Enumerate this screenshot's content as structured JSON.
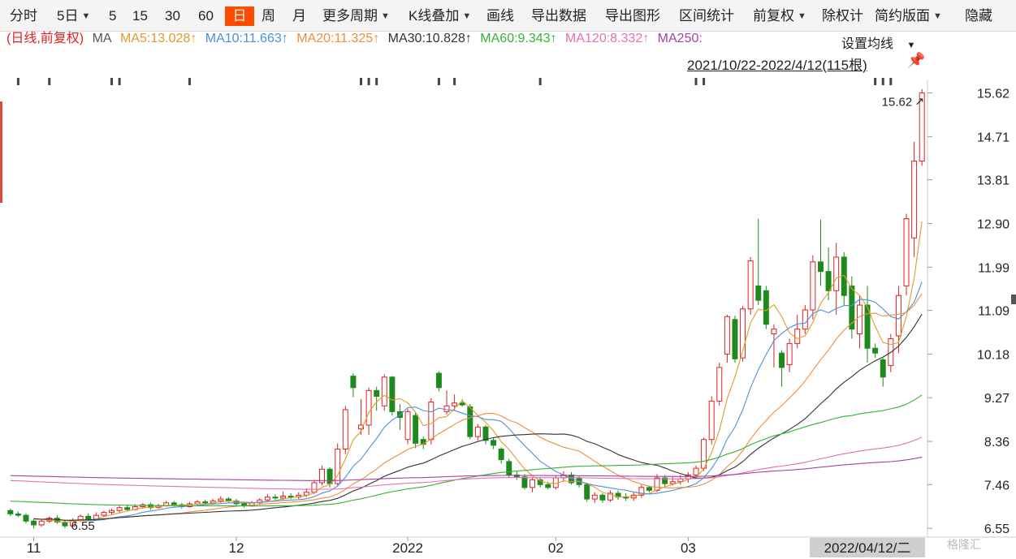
{
  "toolbar": {
    "items": [
      {
        "label": "分时"
      },
      {
        "label": "5日"
      },
      {
        "label": "5"
      },
      {
        "label": "15"
      },
      {
        "label": "30"
      },
      {
        "label": "60"
      },
      {
        "label": "日"
      },
      {
        "label": "周"
      },
      {
        "label": "月"
      },
      {
        "label": "更多周期"
      },
      {
        "label": "K线叠加"
      },
      {
        "label": "画线"
      },
      {
        "label": "导出数据"
      },
      {
        "label": "导出图形"
      },
      {
        "label": "区间统计"
      },
      {
        "label": "前复权"
      },
      {
        "label": "除权计"
      },
      {
        "label": "简约版面"
      },
      {
        "label": "隐藏"
      }
    ],
    "active": "日"
  },
  "ma_legend": {
    "prefix": "(日线,前复权)",
    "ma_label": "MA",
    "items": [
      {
        "text": "MA5:13.028↑",
        "color": "#e39a29"
      },
      {
        "text": "MA10:11.663↑",
        "color": "#4a90d9"
      },
      {
        "text": "MA20:11.325↑",
        "color": "#f08c3a"
      },
      {
        "text": "MA30:10.828↑",
        "color": "#333333"
      },
      {
        "text": "MA60:9.343↑",
        "color": "#34b234"
      },
      {
        "text": "MA120:8.332↑",
        "color": "#e86fb1"
      },
      {
        "text": "MA250:",
        "color": "#a640a6"
      }
    ],
    "settings_label": "设置均线"
  },
  "range_label": "2021/10/22-2022/4/12(115根)",
  "watermark": "格隆汇",
  "colors": {
    "up": "#e02020",
    "down": "#1e8a1e",
    "active_tab": "#ff4a00"
  },
  "chart_data": {
    "type": "candlestick",
    "ylim": [
      6.4,
      15.9
    ],
    "y_ticks": [
      "15.62",
      "14.71",
      "13.81",
      "12.90",
      "11.99",
      "11.09",
      "10.18",
      "9.27",
      "8.36",
      "7.46",
      "6.55"
    ],
    "x_labels": [
      "11",
      "12",
      "2022",
      "02",
      "03"
    ],
    "current_date_label": "2022/04/12/二",
    "high_annotation": "15.62",
    "low_annotation": "6.55",
    "candles": [
      [
        6.92,
        6.85,
        6.96,
        6.8
      ],
      [
        6.85,
        6.82,
        6.9,
        6.78
      ],
      [
        6.82,
        6.7,
        6.86,
        6.65
      ],
      [
        6.7,
        6.62,
        6.75,
        6.55
      ],
      [
        6.62,
        6.7,
        6.74,
        6.58
      ],
      [
        6.7,
        6.76,
        6.8,
        6.66
      ],
      [
        6.76,
        6.68,
        6.82,
        6.64
      ],
      [
        6.68,
        6.6,
        6.72,
        6.55
      ],
      [
        6.6,
        6.72,
        6.76,
        6.58
      ],
      [
        6.72,
        6.8,
        6.84,
        6.68
      ],
      [
        6.8,
        6.74,
        6.86,
        6.7
      ],
      [
        6.74,
        6.82,
        6.88,
        6.72
      ],
      [
        6.82,
        6.88,
        6.92,
        6.78
      ],
      [
        6.88,
        6.92,
        6.96,
        6.84
      ],
      [
        6.92,
        6.98,
        7.02,
        6.88
      ],
      [
        6.98,
        6.94,
        7.04,
        6.9
      ],
      [
        6.94,
        7.0,
        7.05,
        6.92
      ],
      [
        7.0,
        7.04,
        7.08,
        6.96
      ],
      [
        7.04,
        6.98,
        7.08,
        6.94
      ],
      [
        6.98,
        7.02,
        7.06,
        6.96
      ],
      [
        7.02,
        7.08,
        7.12,
        7.0
      ],
      [
        7.08,
        7.04,
        7.12,
        7.0
      ],
      [
        7.04,
        7.0,
        7.08,
        6.96
      ],
      [
        7.0,
        7.06,
        7.1,
        6.98
      ],
      [
        7.06,
        7.1,
        7.14,
        7.02
      ],
      [
        7.1,
        7.08,
        7.14,
        7.04
      ],
      [
        7.08,
        7.12,
        7.16,
        7.04
      ],
      [
        7.12,
        7.16,
        7.22,
        7.08
      ],
      [
        7.16,
        7.12,
        7.2,
        7.08
      ],
      [
        7.12,
        7.06,
        7.16,
        7.02
      ],
      [
        7.06,
        7.02,
        7.1,
        6.98
      ],
      [
        7.02,
        7.08,
        7.12,
        7.0
      ],
      [
        7.08,
        7.14,
        7.18,
        7.04
      ],
      [
        7.14,
        7.2,
        7.26,
        7.1
      ],
      [
        7.2,
        7.18,
        7.26,
        7.14
      ],
      [
        7.18,
        7.22,
        7.32,
        7.14
      ],
      [
        7.22,
        7.2,
        7.28,
        7.16
      ],
      [
        7.2,
        7.24,
        7.3,
        7.16
      ],
      [
        7.24,
        7.3,
        7.38,
        7.2
      ],
      [
        7.3,
        7.5,
        7.56,
        7.26
      ],
      [
        7.5,
        7.78,
        7.86,
        7.44
      ],
      [
        7.78,
        7.48,
        7.82,
        7.4
      ],
      [
        7.48,
        8.2,
        8.32,
        7.44
      ],
      [
        8.2,
        9.02,
        9.1,
        8.1
      ],
      [
        9.72,
        9.48,
        9.78,
        9.28
      ],
      [
        8.62,
        8.7,
        9.24,
        8.5
      ],
      [
        8.7,
        9.42,
        9.48,
        8.5
      ],
      [
        9.42,
        9.3,
        9.5,
        9.0
      ],
      [
        9.1,
        9.7,
        9.76,
        9.0
      ],
      [
        9.7,
        8.98,
        9.72,
        8.9
      ],
      [
        8.98,
        8.86,
        9.14,
        8.6
      ],
      [
        8.4,
        8.98,
        9.04,
        8.3
      ],
      [
        8.9,
        8.32,
        8.96,
        8.22
      ],
      [
        8.4,
        8.3,
        8.46,
        8.2
      ],
      [
        8.4,
        9.18,
        9.26,
        8.3
      ],
      [
        9.78,
        9.48,
        9.82,
        9.4
      ],
      [
        8.98,
        9.1,
        9.42,
        8.92
      ],
      [
        9.1,
        9.16,
        9.34,
        9.0
      ],
      [
        9.16,
        9.12,
        9.24,
        9.08
      ],
      [
        9.08,
        8.46,
        9.14,
        8.4
      ],
      [
        8.46,
        8.66,
        8.72,
        8.38
      ],
      [
        8.66,
        8.38,
        8.7,
        8.3
      ],
      [
        8.38,
        8.28,
        8.44,
        8.2
      ],
      [
        8.2,
        7.98,
        8.24,
        7.9
      ],
      [
        7.94,
        7.66,
        8.0,
        7.6
      ],
      [
        7.66,
        7.62,
        7.74,
        7.56
      ],
      [
        7.62,
        7.4,
        7.68,
        7.36
      ],
      [
        7.4,
        7.56,
        7.6,
        7.3
      ],
      [
        7.56,
        7.46,
        7.62,
        7.4
      ],
      [
        7.46,
        7.4,
        7.52,
        7.36
      ],
      [
        7.4,
        7.6,
        7.66,
        7.36
      ],
      [
        7.6,
        7.66,
        7.74,
        7.52
      ],
      [
        7.66,
        7.5,
        7.72,
        7.46
      ],
      [
        7.6,
        7.46,
        7.64,
        7.4
      ],
      [
        7.46,
        7.16,
        7.5,
        7.1
      ],
      [
        7.16,
        7.24,
        7.3,
        7.08
      ],
      [
        7.24,
        7.14,
        7.28,
        7.08
      ],
      [
        7.14,
        7.28,
        7.34,
        7.1
      ],
      [
        7.28,
        7.2,
        7.34,
        7.14
      ],
      [
        7.2,
        7.18,
        7.28,
        7.12
      ],
      [
        7.18,
        7.24,
        7.3,
        7.12
      ],
      [
        7.24,
        7.4,
        7.46,
        7.18
      ],
      [
        7.4,
        7.34,
        7.44,
        7.3
      ],
      [
        7.34,
        7.6,
        7.68,
        7.3
      ],
      [
        7.6,
        7.48,
        7.66,
        7.42
      ],
      [
        7.48,
        7.52,
        7.62,
        7.44
      ],
      [
        7.52,
        7.58,
        7.66,
        7.46
      ],
      [
        7.58,
        7.66,
        7.72,
        7.5
      ],
      [
        7.66,
        7.8,
        7.86,
        7.6
      ],
      [
        7.8,
        8.4,
        8.44,
        7.74
      ],
      [
        8.4,
        9.2,
        9.3,
        8.3
      ],
      [
        9.2,
        9.9,
        10.0,
        9.1
      ],
      [
        10.18,
        10.96,
        11.0,
        10.0
      ],
      [
        10.9,
        10.08,
        10.98,
        10.0
      ],
      [
        10.1,
        11.12,
        11.18,
        10.02
      ],
      [
        11.12,
        12.12,
        12.2,
        11.0
      ],
      [
        11.6,
        11.3,
        13.0,
        11.2
      ],
      [
        11.5,
        10.8,
        11.6,
        10.7
      ],
      [
        10.6,
        10.7,
        10.8,
        9.9
      ],
      [
        10.2,
        9.9,
        10.26,
        9.5
      ],
      [
        9.96,
        10.4,
        10.5,
        9.8
      ],
      [
        10.4,
        10.7,
        11.0,
        10.3
      ],
      [
        10.7,
        11.1,
        11.2,
        10.6
      ],
      [
        11.1,
        12.1,
        12.24,
        10.9
      ],
      [
        12.1,
        11.9,
        12.98,
        11.6
      ],
      [
        11.9,
        11.5,
        12.4,
        11.3
      ],
      [
        11.5,
        12.2,
        12.5,
        11.0
      ],
      [
        12.2,
        11.4,
        12.3,
        11.2
      ],
      [
        11.6,
        10.7,
        11.8,
        10.5
      ],
      [
        10.6,
        11.2,
        11.4,
        10.3
      ],
      [
        11.2,
        10.3,
        11.6,
        10.0
      ],
      [
        10.3,
        10.2,
        10.4,
        10.1
      ],
      [
        10.06,
        9.7,
        10.1,
        9.5
      ],
      [
        9.94,
        10.5,
        10.6,
        9.8
      ],
      [
        10.56,
        11.4,
        11.6,
        10.2
      ],
      [
        11.6,
        13.0,
        13.1,
        11.4
      ],
      [
        12.6,
        14.2,
        14.6,
        12.2
      ],
      [
        14.2,
        15.62,
        15.7,
        14.1
      ]
    ],
    "ma_lines": [
      {
        "name": "MA5",
        "color": "#e39a29",
        "values_anchor": "computed"
      },
      {
        "name": "MA10",
        "color": "#4a90d9",
        "values_anchor": "computed"
      },
      {
        "name": "MA20",
        "color": "#f08c3a",
        "values_anchor": "computed"
      },
      {
        "name": "MA30",
        "color": "#333333",
        "values_anchor": "computed"
      },
      {
        "name": "MA60",
        "color": "#34b234",
        "values_anchor": "computed"
      },
      {
        "name": "MA120",
        "color": "#e86fb1",
        "values_anchor": "computed"
      },
      {
        "name": "MA250",
        "color": "#a640a6",
        "values_anchor": "computed"
      }
    ]
  }
}
